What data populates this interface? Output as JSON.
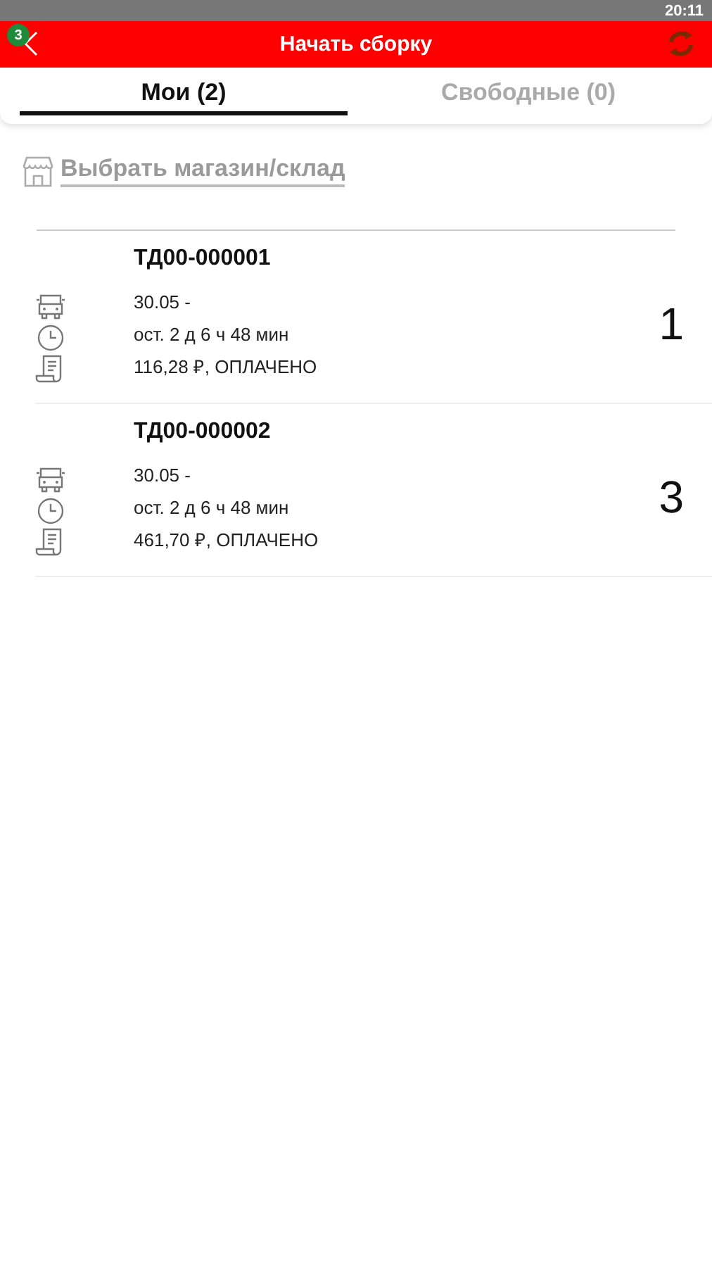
{
  "status_bar": {
    "time": "20:11"
  },
  "toolbar": {
    "badge": "3",
    "title": "Начать сборку"
  },
  "tabs": [
    {
      "label": "Мои (2)",
      "selected": true
    },
    {
      "label": "Свободные (0)",
      "selected": false
    }
  ],
  "store_link": "Выбрать магазин/склад",
  "orders": [
    {
      "number": "ТД00-000001",
      "date": "30.05  -",
      "remaining": "ост. 2 д 6 ч 48 мин",
      "payment": "116,28 ₽, ОПЛАЧЕНО",
      "count": "1"
    },
    {
      "number": "ТД00-000002",
      "date": "30.05  -",
      "remaining": "ост. 2 д 6 ч 48 мин",
      "payment": "461,70 ₽, ОПЛАЧЕНО",
      "count": "3"
    }
  ]
}
